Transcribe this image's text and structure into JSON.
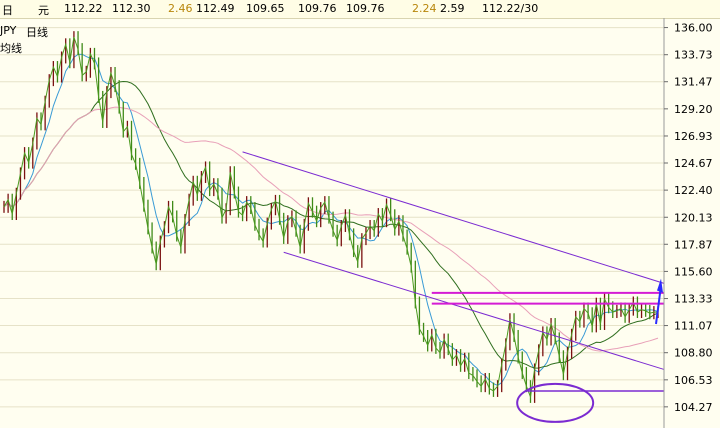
{
  "toolbar": {
    "date_label": "日",
    "unit_label": "元",
    "open": "112.22",
    "high": "112.30",
    "change": "2.46",
    "v1": "112.49",
    "v2": "109.65",
    "v3": "109.76",
    "v4": "109.76",
    "change2": "2.24",
    "v5": "2.59",
    "range": "112.22/30"
  },
  "chart_header": {
    "symbol": "JPY",
    "period": "日线",
    "line2": "均线"
  },
  "chart_data": {
    "type": "line",
    "y_ticks": [
      "136.00",
      "133.73",
      "131.47",
      "129.20",
      "126.93",
      "124.67",
      "122.40",
      "120.13",
      "117.87",
      "115.60",
      "113.33",
      "111.07",
      "108.80",
      "106.53",
      "104.27"
    ],
    "ylim": [
      102.5,
      136.8
    ],
    "n_bars": 160,
    "price": [
      121.0,
      121.6,
      120.4,
      122.1,
      123.8,
      125.5,
      124.7,
      126.3,
      128.4,
      127.9,
      129.8,
      131.6,
      132.7,
      131.9,
      133.5,
      134.6,
      133.1,
      135.2,
      134.2,
      132.0,
      132.3,
      133.8,
      133.0,
      130.2,
      128.1,
      130.6,
      132.2,
      131.1,
      129.3,
      127.3,
      127.7,
      125.4,
      124.6,
      123.0,
      121.1,
      119.2,
      117.6,
      116.2,
      118.1,
      119.3,
      121.0,
      120.2,
      118.6,
      117.6,
      119.9,
      121.6,
      123.1,
      122.0,
      123.5,
      124.3,
      122.4,
      122.9,
      122.1,
      120.1,
      120.8,
      123.9,
      122.2,
      120.6,
      120.3,
      121.4,
      120.9,
      119.5,
      118.7,
      118.1,
      119.6,
      120.8,
      121.5,
      120.0,
      118.4,
      119.8,
      120.2,
      119.0,
      117.6,
      119.5,
      121.3,
      120.6,
      119.8,
      120.9,
      121.4,
      120.1,
      119.0,
      118.2,
      119.4,
      120.3,
      118.7,
      117.3,
      116.4,
      118.3,
      118.8,
      119.4,
      119.0,
      120.4,
      119.8,
      121.2,
      120.3,
      119.1,
      119.8,
      118.6,
      117.5,
      116.0,
      113.0,
      110.8,
      110.2,
      109.4,
      110.3,
      109.2,
      108.8,
      109.9,
      109.1,
      108.2,
      108.6,
      107.7,
      108.3,
      107.1,
      106.9,
      106.4,
      106.0,
      106.6,
      105.8,
      105.6,
      106.0,
      107.8,
      109.5,
      111.6,
      110.2,
      108.4,
      107.1,
      106.0,
      105.1,
      107.4,
      109.0,
      110.5,
      109.9,
      111.2,
      110.0,
      108.5,
      107.0,
      108.8,
      110.3,
      111.8,
      111.4,
      112.5,
      112.1,
      111.0,
      112.9,
      111.2,
      113.3,
      112.6,
      112.2,
      112.3,
      112.5,
      111.8,
      112.4,
      113.0,
      112.2,
      112.4,
      112.3,
      112.1,
      112.2,
      112.2
    ]
  },
  "legend": {
    "ma_short": "#3a9bd5",
    "ma_mid": "#2f6e1f",
    "ma_long": "#e8a0b8",
    "price": "#4b9a1f",
    "channel": "#7b2bd1",
    "resistance": "#d41cd4"
  }
}
